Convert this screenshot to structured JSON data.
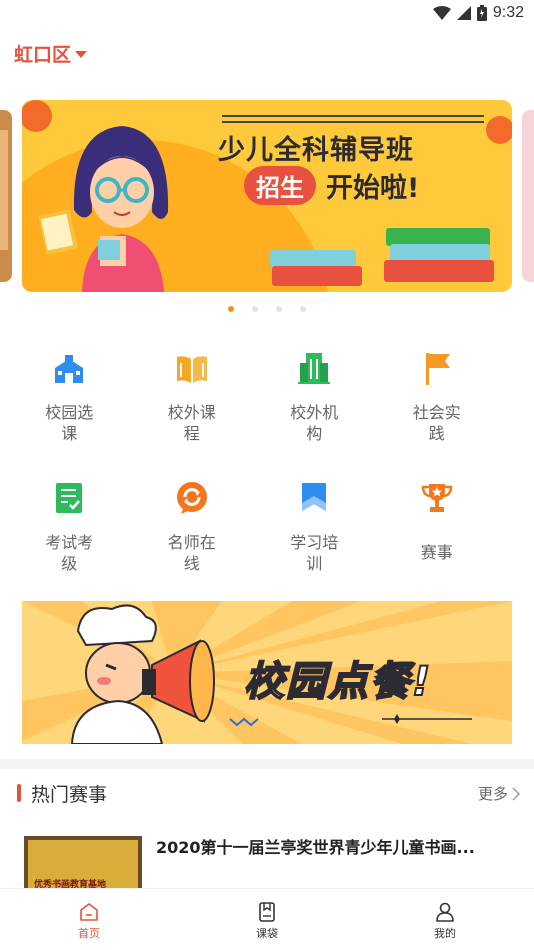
{
  "status_bar": {
    "time": "9:32"
  },
  "location": {
    "label": "虹口区"
  },
  "banner": {
    "title": "少儿全科辅导班",
    "badge": "招生",
    "subtitle": "开始啦!",
    "page_count": 4,
    "active_index": 0
  },
  "grid": [
    {
      "id": "campus-course",
      "label": "校园选课",
      "icon": "school-building-icon",
      "color": "#2f8cf0"
    },
    {
      "id": "extra-course",
      "label": "校外课程",
      "icon": "open-book-icon",
      "color": "#f5a623"
    },
    {
      "id": "extra-org",
      "label": "校外机构",
      "icon": "office-building-icon",
      "color": "#2dbb5b"
    },
    {
      "id": "social-practice",
      "label": "社会实践",
      "icon": "flag-icon",
      "color": "#f59a23"
    },
    {
      "id": "exam-grade",
      "label": "考试考级",
      "icon": "checklist-icon",
      "color": "#2dbb5b"
    },
    {
      "id": "teacher-online",
      "label": "名师在线",
      "icon": "chat-refresh-icon",
      "color": "#f5751e"
    },
    {
      "id": "study-training",
      "label": "学习培训",
      "icon": "bookmark-icon",
      "color": "#2f8cf0"
    },
    {
      "id": "competition",
      "label": "赛事",
      "icon": "trophy-icon",
      "color": "#f07a1e"
    }
  ],
  "promo": {
    "text": "校园点餐!"
  },
  "section": {
    "title": "热门赛事",
    "more": "更多"
  },
  "events": [
    {
      "title": "2020第十一届兰亭奖世界青少年儿童书画...",
      "thumb_text": "优秀书画教育基地"
    }
  ],
  "tabbar": [
    {
      "label": "首页",
      "icon": "home-icon",
      "active": true
    },
    {
      "label": "课袋",
      "icon": "course-bag-icon",
      "active": false
    },
    {
      "label": "我的",
      "icon": "profile-icon",
      "active": false
    }
  ],
  "colors": {
    "accent": "#e5533d",
    "dot_active": "#ff8a1c"
  }
}
